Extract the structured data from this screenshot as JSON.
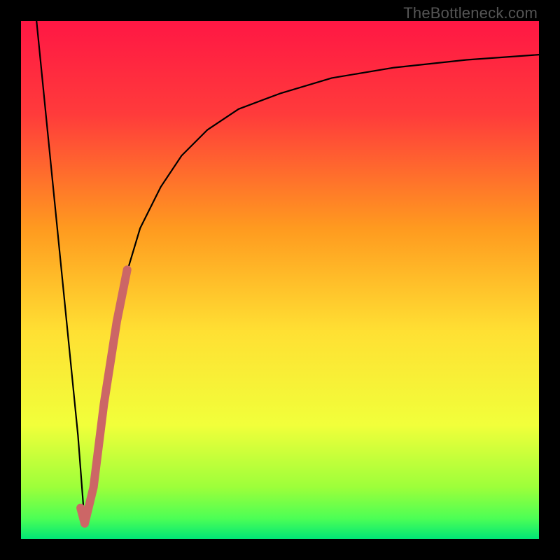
{
  "watermark": "TheBottleneck.com",
  "chart_data": {
    "type": "line",
    "title": "",
    "xlabel": "",
    "ylabel": "",
    "xlim": [
      0,
      100
    ],
    "ylim": [
      0,
      100
    ],
    "grid": false,
    "gradient_stops": [
      {
        "offset": 0.0,
        "color": "#ff1744"
      },
      {
        "offset": 0.18,
        "color": "#ff3b3b"
      },
      {
        "offset": 0.4,
        "color": "#ff9a1f"
      },
      {
        "offset": 0.6,
        "color": "#ffe033"
      },
      {
        "offset": 0.78,
        "color": "#f1ff3a"
      },
      {
        "offset": 0.9,
        "color": "#9dff3a"
      },
      {
        "offset": 0.96,
        "color": "#4dff55"
      },
      {
        "offset": 1.0,
        "color": "#00e676"
      }
    ],
    "series": [
      {
        "name": "bottleneck-curve",
        "color": "#000000",
        "x": [
          3,
          5,
          7,
          9,
          11,
          12.3,
          14,
          16,
          18,
          20,
          23,
          27,
          31,
          36,
          42,
          50,
          60,
          72,
          86,
          100
        ],
        "y": [
          100,
          80,
          60,
          40,
          20,
          3,
          10,
          26,
          40,
          50,
          60,
          68,
          74,
          79,
          83,
          86,
          89,
          91,
          92.5,
          93.5
        ]
      },
      {
        "name": "highlight-segment",
        "color": "#cc6666",
        "thick": true,
        "x": [
          11.5,
          12.3,
          14.0,
          16.0,
          18.5,
          20.5
        ],
        "y": [
          6,
          3,
          10,
          26,
          42,
          52
        ]
      }
    ],
    "annotations": []
  }
}
